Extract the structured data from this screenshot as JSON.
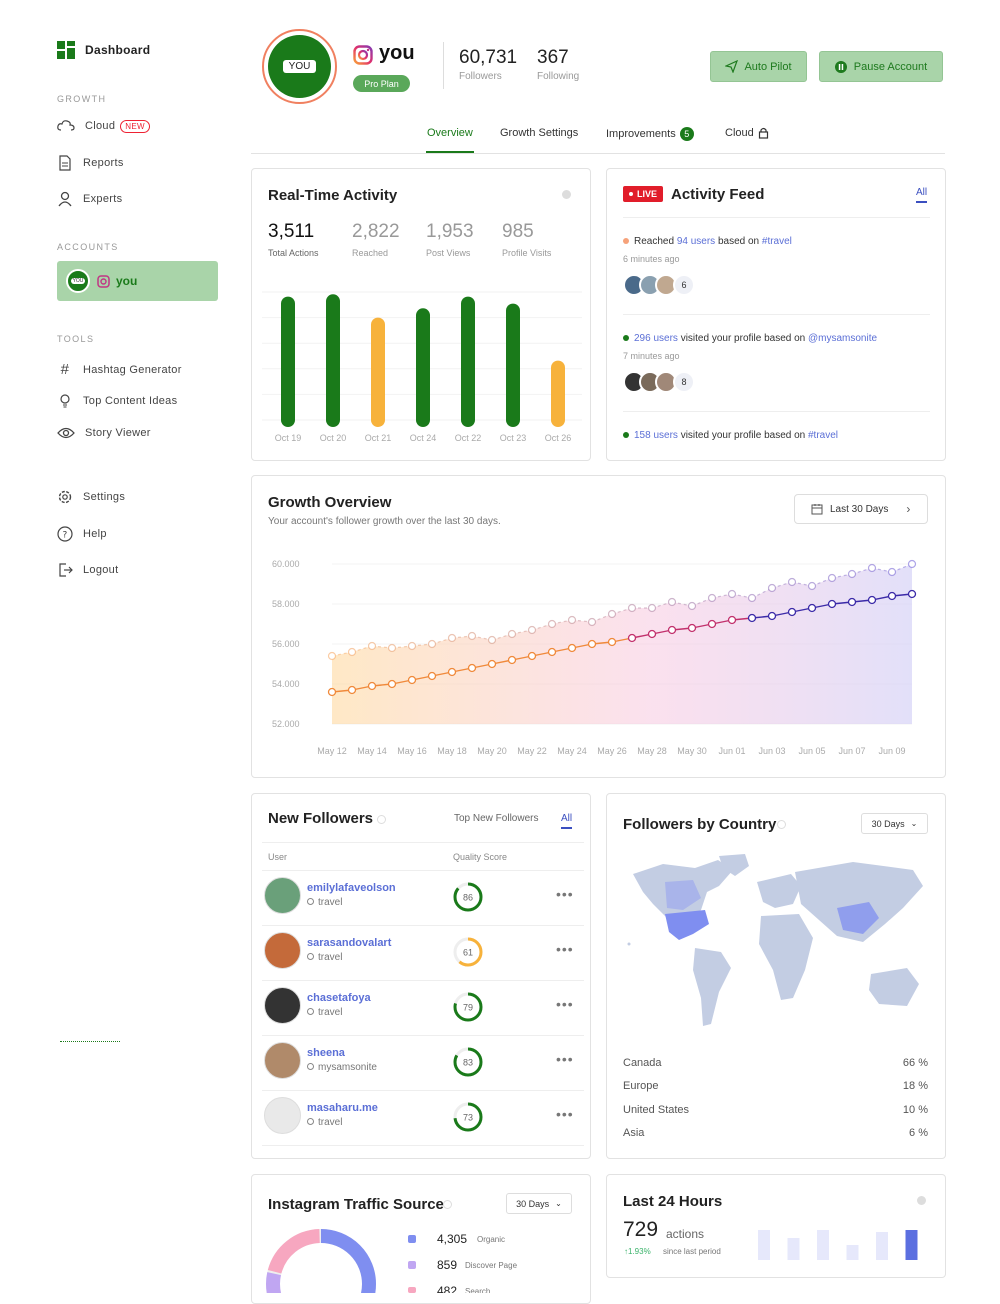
{
  "sidebar": {
    "dashboard_label": "Dashboard",
    "growth_section": "GROWTH",
    "items_growth": [
      {
        "label": "Cloud",
        "badge": "NEW"
      },
      {
        "label": "Reports"
      },
      {
        "label": "Experts"
      }
    ],
    "accounts_section": "ACCOUNTS",
    "account": {
      "avatar_text": "YOU",
      "name": "you"
    },
    "tools_section": "TOOLS",
    "items_tools": [
      {
        "label": "Hashtag Generator"
      },
      {
        "label": "Top Content Ideas"
      },
      {
        "label": "Story Viewer"
      }
    ],
    "items_bottom": [
      {
        "label": "Settings"
      },
      {
        "label": "Help"
      },
      {
        "label": "Logout"
      }
    ]
  },
  "profile": {
    "avatar_text": "YOU",
    "username": "you",
    "plan_badge": "Pro Plan",
    "followers_value": "60,731",
    "followers_label": "Followers",
    "following_value": "367",
    "following_label": "Following",
    "autopilot_label": "Auto Pilot",
    "pause_label": "Pause Account"
  },
  "tabs": {
    "overview": "Overview",
    "growth_settings": "Growth Settings",
    "improvements": "Improvements",
    "improvements_count": "5",
    "cloud": "Cloud"
  },
  "realtime": {
    "title": "Real-Time Activity",
    "stats": [
      {
        "value": "3,511",
        "label": "Total Actions"
      },
      {
        "value": "2,822",
        "label": "Reached"
      },
      {
        "value": "1,953",
        "label": "Post Views"
      },
      {
        "value": "985",
        "label": "Profile Visits"
      }
    ]
  },
  "activity": {
    "live_badge": "LIVE",
    "title": "Activity Feed",
    "filter": "All",
    "items": [
      {
        "pre": "Reached ",
        "count": "94 users",
        "mid": " based on ",
        "tag": "#travel",
        "time": "6 minutes ago",
        "more": "6"
      },
      {
        "pre": "",
        "count": "296 users",
        "mid": " visited your profile based on ",
        "tag": "@mysamsonite",
        "time": "7 minutes ago",
        "more": "8"
      },
      {
        "pre": "",
        "count": "158 users",
        "mid": " visited your profile based on ",
        "tag": "#travel"
      }
    ]
  },
  "growth": {
    "title": "Growth Overview",
    "subtitle": "Your account's follower growth over the last 30 days.",
    "range_label": "Last 30 Days"
  },
  "followers": {
    "title": "New Followers",
    "tab_top": "Top New Followers",
    "tab_all": "All",
    "col_user": "User",
    "col_score": "Quality Score",
    "rows": [
      {
        "name": "emilylafaveolson",
        "tag": "travel",
        "score": "86"
      },
      {
        "name": "sarasandovalart",
        "tag": "travel",
        "score": "61"
      },
      {
        "name": "chasetafoya",
        "tag": "travel",
        "score": "79"
      },
      {
        "name": "sheena",
        "tag": "mysamsonite",
        "score": "83"
      },
      {
        "name": "masaharu.me",
        "tag": "travel",
        "score": "73"
      }
    ]
  },
  "country": {
    "title": "Followers by Country",
    "range": "30 Days",
    "rows": [
      {
        "name": "Canada",
        "pct": "66 %"
      },
      {
        "name": "Europe",
        "pct": "18 %"
      },
      {
        "name": "United States",
        "pct": "10 %"
      },
      {
        "name": "Asia",
        "pct": "6 %"
      }
    ]
  },
  "traffic": {
    "title": "Instagram Traffic Source",
    "range": "30 Days",
    "rows": [
      {
        "value": "4,305",
        "label": "Organic"
      },
      {
        "value": "859",
        "label": "Discover Page"
      },
      {
        "value": "482",
        "label": "Search"
      }
    ]
  },
  "last24": {
    "title": "Last 24 Hours",
    "value": "729",
    "unit": "actions",
    "delta": "↑1.93%",
    "delta_label": "since last period"
  },
  "colors": {
    "brand_green": "#1a7a1a",
    "accent_blue": "#5b6fd6",
    "orange": "#f7b23b"
  },
  "chart_data": [
    {
      "type": "bar",
      "categories": [
        "Oct 19",
        "Oct 20",
        "Oct 21",
        "Oct 24",
        "Oct 22",
        "Oct 23",
        "Oct 26"
      ],
      "values": [
        100,
        102,
        82,
        90,
        100,
        94,
        45
      ],
      "colors": [
        "#1a7a1a",
        "#1a7a1a",
        "#f7b23b",
        "#1a7a1a",
        "#1a7a1a",
        "#1a7a1a",
        "#f7b23b"
      ],
      "ylim": [
        0,
        110
      ]
    },
    {
      "type": "line",
      "x": [
        "May 12",
        "May 13",
        "May 14",
        "May 15",
        "May 16",
        "May 17",
        "May 18",
        "May 19",
        "May 20",
        "May 21",
        "May 22",
        "May 23",
        "May 24",
        "May 25",
        "May 26",
        "May 27",
        "May 28",
        "May 29",
        "May 30",
        "May 31",
        "Jun 01",
        "Jun 02",
        "Jun 03",
        "Jun 04",
        "Jun 05",
        "Jun 06",
        "Jun 07",
        "Jun 08",
        "Jun 09",
        "Jun 10"
      ],
      "xticks": [
        "May 12",
        "May 14",
        "May 16",
        "May 18",
        "May 20",
        "May 22",
        "May 24",
        "May 26",
        "May 28",
        "May 30",
        "Jun 01",
        "Jun 03",
        "Jun 05",
        "Jun 07",
        "Jun 09"
      ],
      "yticks": [
        "60.000",
        "58.000",
        "56.000",
        "54.000",
        "52.000"
      ],
      "ylim": [
        52000,
        60000
      ],
      "series": [
        {
          "values": [
            55400,
            55600,
            55900,
            55800,
            55900,
            56000,
            56300,
            56400,
            56200,
            56500,
            56700,
            57000,
            57200,
            57100,
            57500,
            57800,
            57800,
            58100,
            57900,
            58300,
            58500,
            58300,
            58800,
            59100,
            58900,
            59300,
            59500,
            59800,
            59600,
            60000
          ],
          "style": "dashed"
        },
        {
          "values": [
            53600,
            53700,
            53900,
            54000,
            54200,
            54400,
            54600,
            54800,
            55000,
            55200,
            55400,
            55600,
            55800,
            56000,
            56100,
            56300,
            56500,
            56700,
            56800,
            57000,
            57200,
            57300,
            57400,
            57600,
            57800,
            58000,
            58100,
            58200,
            58400,
            58500
          ],
          "style": "solid"
        }
      ]
    },
    {
      "type": "bar",
      "values": [
        30,
        22,
        30,
        15,
        28,
        30
      ],
      "highlight_index": 5
    },
    {
      "type": "pie",
      "categories": [
        "Organic",
        "Discover Page",
        "Search"
      ],
      "values": [
        4305,
        859,
        482
      ],
      "colors": [
        "#7f8ef0",
        "#c0a6f2",
        "#f7a7c0"
      ]
    }
  ]
}
